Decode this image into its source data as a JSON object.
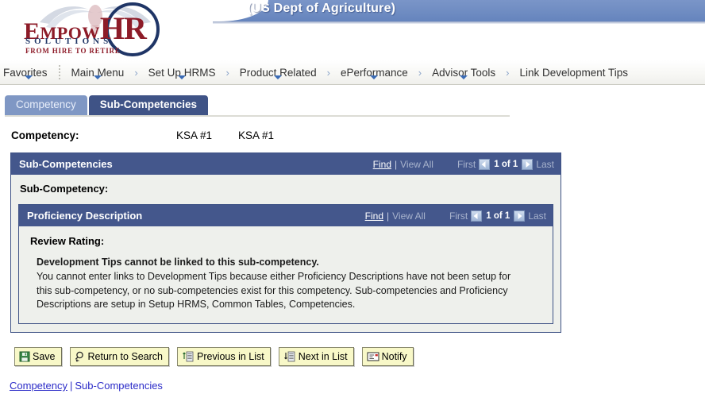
{
  "header": {
    "banner_title": "(US Dept of Agriculture)",
    "logo": {
      "word_empow": "MPOW",
      "word_e": "E",
      "word_hr": "HR",
      "solutions": "SOLUTIONS",
      "tagline": "FROM HIRE TO RETIRE"
    },
    "colors": {
      "banner_blue": "#6f8cc2",
      "logo_red": "#8d1b28",
      "logo_navy": "#1f3566"
    }
  },
  "nav": {
    "items": [
      {
        "label": "Favorites",
        "has_caret": true,
        "has_sep": false
      },
      {
        "label": "Main Menu",
        "has_caret": true,
        "has_sep": true
      },
      {
        "label": "Set Up HRMS",
        "has_caret": true,
        "has_sep": true
      },
      {
        "label": "Product Related",
        "has_caret": true,
        "has_sep": true
      },
      {
        "label": "ePerformance",
        "has_caret": true,
        "has_sep": true
      },
      {
        "label": "Advisor Tools",
        "has_caret": true,
        "has_sep": true
      },
      {
        "label": "Link Development Tips",
        "has_caret": false,
        "has_sep": true
      }
    ],
    "separator": "›"
  },
  "tabs": [
    {
      "label": "Competency",
      "active": false
    },
    {
      "label": "Sub-Competencies",
      "active": true
    }
  ],
  "competency_row": {
    "label": "Competency:",
    "value1": "KSA #1",
    "value2": "KSA #1"
  },
  "outer_panel": {
    "title": "Sub-Competencies",
    "find_label": "Find",
    "pipe": "|",
    "view_all_label": "View All",
    "first_label": "First",
    "page_indicator": "1 of 1",
    "last_label": "Last",
    "field_label": "Sub-Competency:"
  },
  "inner_panel": {
    "title": "Proficiency Description",
    "find_label": "Find",
    "pipe": "|",
    "view_all_label": "View All",
    "first_label": "First",
    "page_indicator": "1 of 1",
    "last_label": "Last",
    "field_label": "Review Rating:",
    "message_bold": "Development Tips cannot be linked to this sub-competency.",
    "message_body": "You cannot enter links to Development Tips because either Proficiency Descriptions have not been setup for this sub-competency, or no sub-competencies exist for this competency. Sub-competencies and Proficiency Descriptions are setup in Setup HRMS, Common Tables, Competencies."
  },
  "buttons": [
    {
      "label": "Save",
      "icon": "floppy-disk-icon"
    },
    {
      "label": "Return to Search",
      "icon": "magnifier-return-icon"
    },
    {
      "label": "Previous in List",
      "icon": "up-arrow-list-icon"
    },
    {
      "label": "Next in List",
      "icon": "down-arrow-list-icon"
    },
    {
      "label": "Notify",
      "icon": "envelope-notify-icon"
    }
  ],
  "footer": {
    "link1": "Competency",
    "separator": "|",
    "link2": "Sub-Competencies"
  }
}
